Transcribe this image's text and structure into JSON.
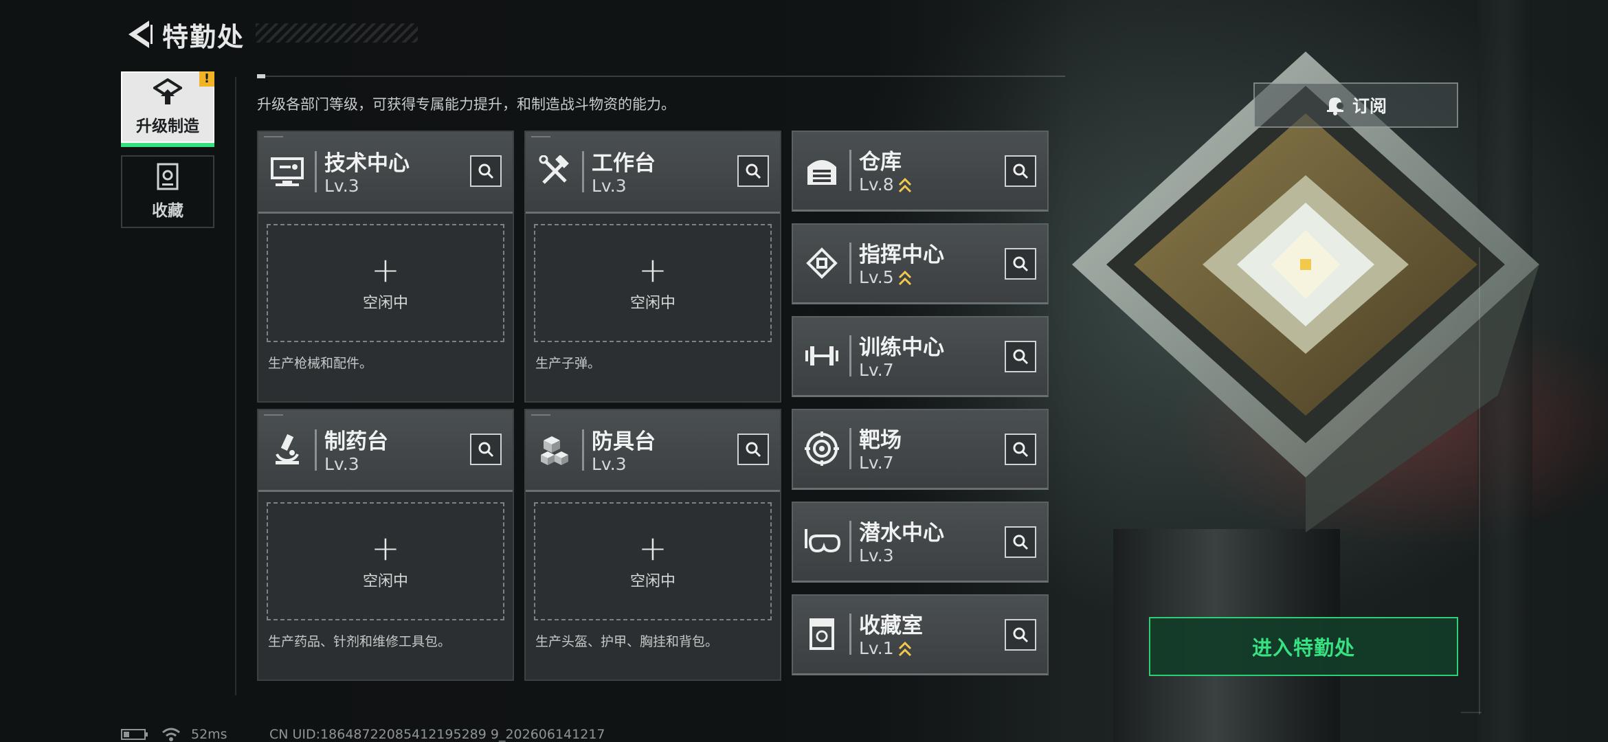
{
  "header": {
    "title": "特勤处"
  },
  "tabs": [
    {
      "label": "升级制造",
      "badge": "!"
    },
    {
      "label": "收藏"
    }
  ],
  "description": "升级各部门等级，可获得专属能力提升，和制造战斗物资的能力。",
  "stations": [
    {
      "name": "技术中心",
      "level": "Lv.3",
      "slot": {
        "plus": "+",
        "label": "空闲中"
      },
      "note": "生产枪械和配件。",
      "icon": "computer-icon"
    },
    {
      "name": "工作台",
      "level": "Lv.3",
      "slot": {
        "plus": "+",
        "label": "空闲中"
      },
      "note": "生产子弹。",
      "icon": "tools-icon"
    },
    {
      "name": "制药台",
      "level": "Lv.3",
      "slot": {
        "plus": "+",
        "label": "空闲中"
      },
      "note": "生产药品、针剂和维修工具包。",
      "icon": "microscope-icon"
    },
    {
      "name": "防具台",
      "level": "Lv.3",
      "slot": {
        "plus": "+",
        "label": "空闲中"
      },
      "note": "生产头盔、护甲、胸挂和背包。",
      "icon": "blocks-icon"
    }
  ],
  "facilities": [
    {
      "name": "仓库",
      "level": "Lv.8",
      "upgradable": true,
      "icon": "warehouse-icon"
    },
    {
      "name": "指挥中心",
      "level": "Lv.5",
      "upgradable": true,
      "icon": "chip-icon"
    },
    {
      "name": "训练中心",
      "level": "Lv.7",
      "upgradable": false,
      "icon": "dumbbell-icon"
    },
    {
      "name": "靶场",
      "level": "Lv.7",
      "upgradable": false,
      "icon": "target-icon"
    },
    {
      "name": "潜水中心",
      "level": "Lv.3",
      "upgradable": false,
      "icon": "diving-mask-icon"
    },
    {
      "name": "收藏室",
      "level": "Lv.1",
      "upgradable": true,
      "icon": "collection-icon"
    }
  ],
  "subscribe": {
    "label": "订阅",
    "icon": "bell-icon"
  },
  "enter": {
    "label": "进入特勤处"
  },
  "status": {
    "ping": "52ms",
    "uid": "CN UID:18648722085412195289 9_202606141217"
  },
  "colors": {
    "accent": "#36e07e",
    "upgrade": "#f2c94c",
    "badge": "#f2b325"
  }
}
